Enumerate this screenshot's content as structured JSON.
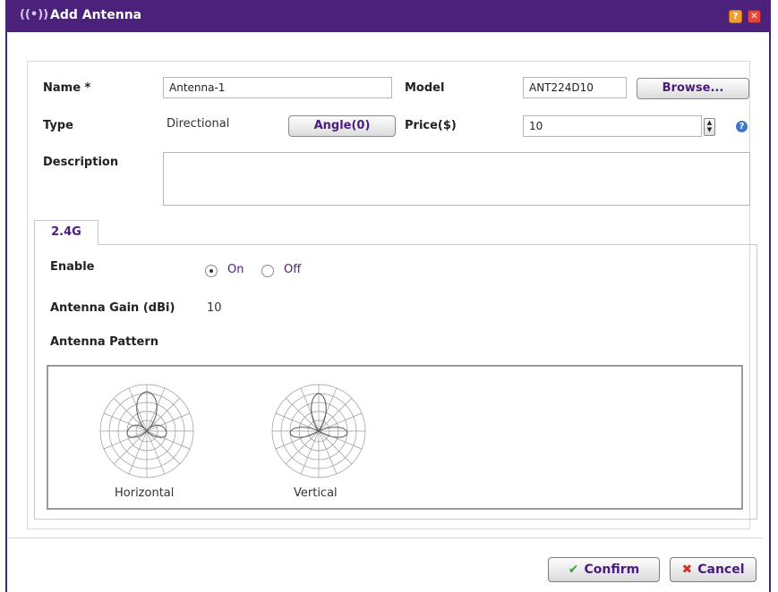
{
  "window": {
    "title": "Add Antenna",
    "title_icon": "antenna-signal-icon",
    "help_icon": "help-icon",
    "close_icon": "close-icon"
  },
  "form": {
    "name_label": "Name *",
    "name_value": "Antenna-1",
    "model_label": "Model",
    "model_value": "ANT224D10",
    "browse_label": "Browse...",
    "type_label": "Type",
    "type_value": "Directional",
    "angle_label": "Angle(0)",
    "price_label": "Price($)",
    "price_value": "10",
    "description_label": "Description",
    "description_value": ""
  },
  "tabs": [
    {
      "label": "2.4G",
      "selected": true
    }
  ],
  "band": {
    "enable_label": "Enable",
    "on_label": "On",
    "off_label": "Off",
    "enabled": true,
    "gain_label": "Antenna Gain (dBi)",
    "gain_value": "10",
    "pattern_label": "Antenna Pattern",
    "horizontal_label": "Horizontal",
    "vertical_label": "Vertical"
  },
  "footer": {
    "confirm_label": "Confirm",
    "cancel_label": "Cancel"
  },
  "colors": {
    "titlebar": "#4c217c",
    "accent_text": "#4b1c7e",
    "confirm_icon": "#3aa13a",
    "cancel_icon": "#d5342a"
  }
}
